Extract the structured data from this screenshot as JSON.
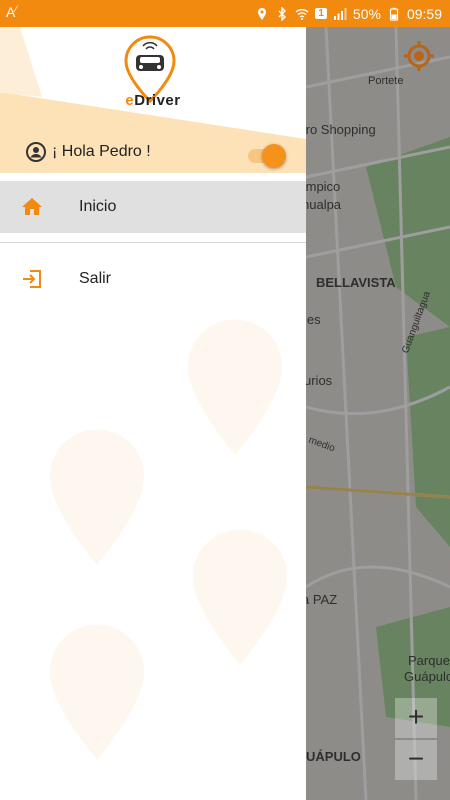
{
  "status_bar": {
    "left_icon": "font-size-icon",
    "battery": "50%",
    "time": "09:59",
    "sim_badge": "1"
  },
  "drawer": {
    "brand": {
      "prefix": "e",
      "rest": "Driver"
    },
    "greeting": "¡ Hola Pedro !",
    "toggle_on": true,
    "menu": [
      {
        "label": "Inicio",
        "icon": "home-icon",
        "active": true
      },
      {
        "label": "Salir",
        "icon": "exit-icon",
        "active": false
      }
    ]
  },
  "map": {
    "labels": [
      "Portete",
      "tro Shopping",
      "ímpico",
      "hualpa",
      "BELLAVISTA",
      "Guanguiltagua",
      "les",
      "urios",
      "medio",
      "a PAZ",
      "Parque",
      "Guápulo",
      "UÁPULO"
    ],
    "zoom_in": "+",
    "zoom_out": "−"
  },
  "colors": {
    "accent": "#f28a10",
    "active_row": "#e0e0e0"
  }
}
